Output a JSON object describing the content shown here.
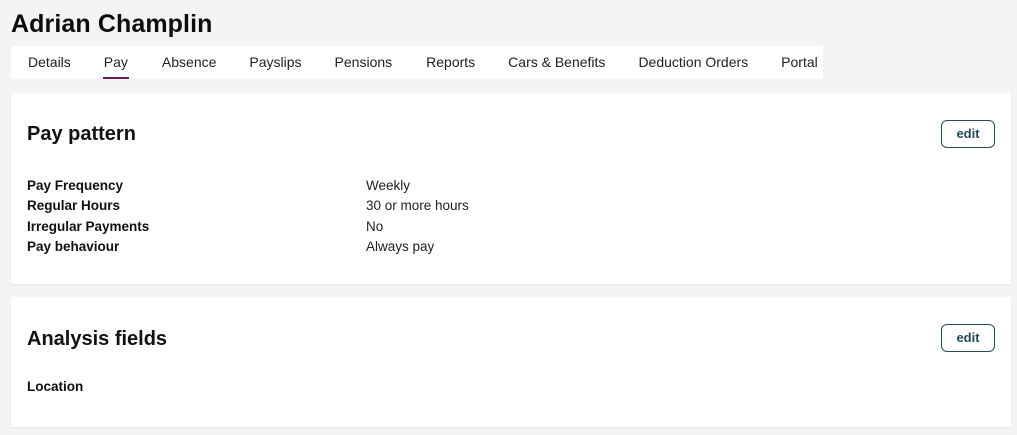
{
  "employee": {
    "name": "Adrian Champlin"
  },
  "tabs": [
    {
      "label": "Details"
    },
    {
      "label": "Pay"
    },
    {
      "label": "Absence"
    },
    {
      "label": "Payslips"
    },
    {
      "label": "Pensions"
    },
    {
      "label": "Reports"
    },
    {
      "label": "Cars & Benefits"
    },
    {
      "label": "Deduction Orders"
    },
    {
      "label": "Portal"
    }
  ],
  "active_tab": "Pay",
  "pay_pattern": {
    "title": "Pay pattern",
    "edit_label": "edit",
    "fields": [
      {
        "label": "Pay Frequency",
        "value": "Weekly"
      },
      {
        "label": "Regular Hours",
        "value": "30 or more hours"
      },
      {
        "label": "Irregular Payments",
        "value": "No"
      },
      {
        "label": "Pay behaviour",
        "value": "Always pay"
      }
    ]
  },
  "analysis_fields": {
    "title": "Analysis fields",
    "edit_label": "edit",
    "fields": [
      {
        "label": "Location",
        "value": ""
      }
    ]
  },
  "colors": {
    "accent_tab_underline": "#6b1f4e",
    "edit_button": "#1f4d5a",
    "background": "#f4f4f4"
  }
}
